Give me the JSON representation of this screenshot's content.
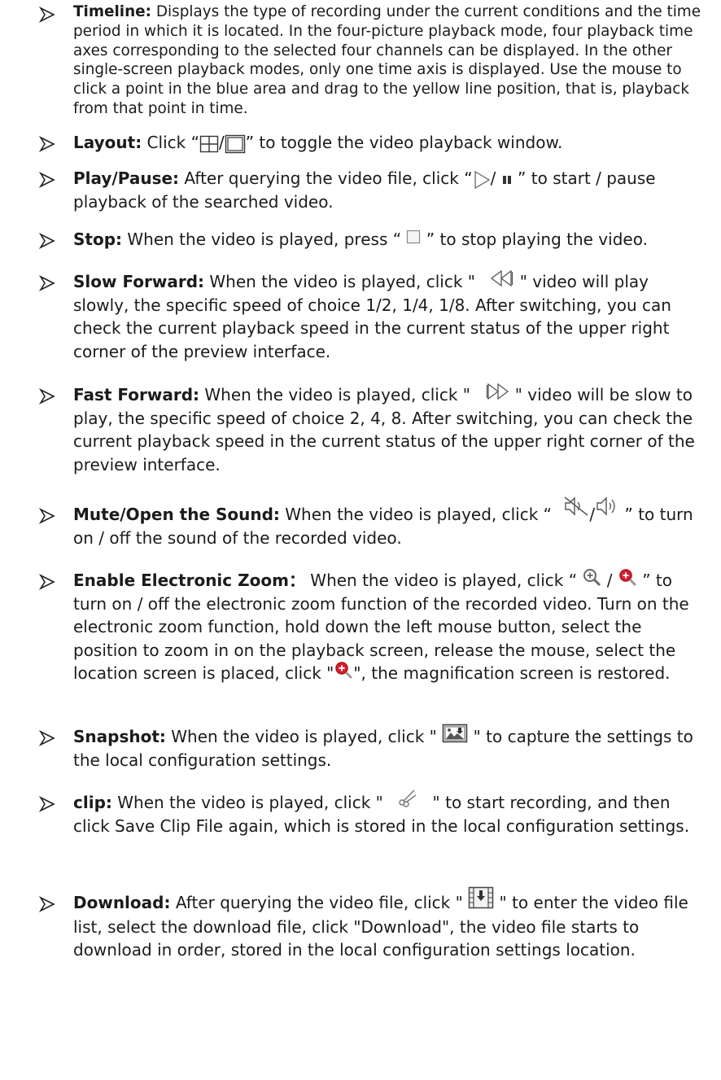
{
  "items": [
    {
      "title": "Timeline:",
      "text": " Displays the type of recording under the current conditions and the time period in which it is located. In the four-picture playback mode, four playback time axes corresponding to the selected four channels can be displayed. In the other single-screen playback modes, only one time axis is displayed. Use the mouse to click a point in the blue area and drag to the yellow line position, that is, playback from that point in time."
    },
    {
      "title": "Layout:",
      "pre": " Click “",
      "sep": "/",
      "post": "” to toggle the video playback window."
    },
    {
      "title": "Play/Pause:",
      "pre": " After querying the video file, click “",
      "sep": "/ ",
      "post": " ” to start / pause playback of the searched video."
    },
    {
      "title": "Stop:",
      "pre": " When the video is played, press “ ",
      "post": " ” to stop playing the video."
    },
    {
      "title": "Slow Forward:",
      "pre": " When the video is played, click \" ",
      "post": " \" video will play slowly, the specific speed of choice 1/2, 1/4, 1/8. After switching, you can check the current playback speed in the current status of the upper right corner of the preview interface."
    },
    {
      "title": "Fast Forward:",
      "pre": " When the video is played, click \" ",
      "post": " \" video will be slow to play, the specific speed of choice 2, 4, 8. After switching, you can check the current playback speed in the current status of the upper right corner of the preview interface."
    },
    {
      "title": "Mute/Open the Sound:",
      "pre": " When the video is played, click “ ",
      "sep": "/",
      "post": " ” to turn on / off the sound of the recorded video."
    },
    {
      "title": "Enable Electronic Zoom",
      "colon": "：",
      "pre": " When the video is played, click “ ",
      "sep": " / ",
      "post1": " ” to turn on / off the electronic zoom function of the recorded video. Turn on the electronic zoom function, hold down the left mouse button, select the position to zoom in on the playback screen, release the mouse, select the location screen is placed, click \"",
      "post2": "\", the magnification screen is restored."
    },
    {
      "title": "Snapshot:",
      "pre": " When the video is played, click \" ",
      "post": " \" to capture the settings to the local configuration settings."
    },
    {
      "title": "clip:",
      "pre": " When the video is played, click \" ",
      "post": " \" to start recording, and then click Save Clip File again, which is stored in the local configuration settings."
    },
    {
      "title": "Download:",
      "pre": " After querying the video file, click \" ",
      "post": " \" to enter the video file list, select the download file, click \"Download\", the video file starts to download in order, stored in the local configuration settings location."
    }
  ],
  "colors": {
    "text": "#1b1b1b",
    "zoom_red": "#d81e2c",
    "icon_gray": "#8a8a8a"
  }
}
